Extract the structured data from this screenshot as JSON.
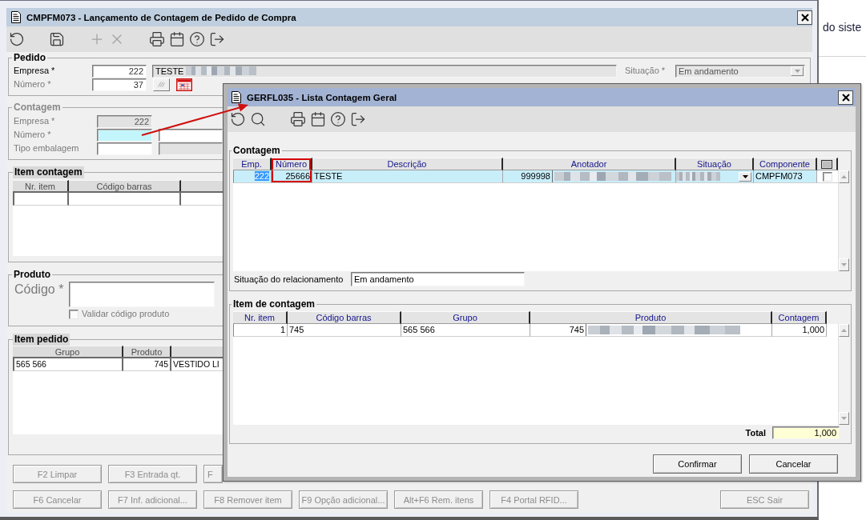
{
  "main_window": {
    "title": "CMPFM073 - Lançamento de Contagem de Pedido de Compra",
    "toolbar_groups": [
      [
        {
          "disabled": false
        }
      ],
      [
        {
          "disabled": false
        }
      ],
      [
        {
          "disabled": true
        },
        {
          "disabled": true
        }
      ],
      [
        {
          "disabled": false
        },
        {
          "disabled": false
        },
        {
          "disabled": false
        },
        {
          "disabled": false
        }
      ]
    ],
    "pedido": {
      "title": "Pedido",
      "disabled": false,
      "highlighted": false,
      "empresa": {
        "label": "Empresa *",
        "disabled": false,
        "value": "222",
        "description": "TESTE",
        "redacted": true
      },
      "numero": {
        "label": "Número *",
        "disabled": true,
        "value": "37"
      },
      "situacao": {
        "label": "Situação *",
        "disabled": true,
        "value": "Em andamento"
      }
    },
    "contagem": {
      "title": "Contagem",
      "disabled": true,
      "highlighted": false,
      "fields": [
        {
          "label": "Empresa *",
          "disabled": true,
          "value": "222",
          "readonly": true,
          "focused": false
        },
        {
          "label": "Número *",
          "disabled": true,
          "readonly": false,
          "focused": true,
          "side_field": {
            "readonly": false
          }
        },
        {
          "label": "Tipo embalagem",
          "disabled": true,
          "readonly": false,
          "focused": false,
          "side_field": {
            "readonly": true
          }
        }
      ]
    },
    "item_contagem": {
      "title": "Item contagem",
      "disabled": false,
      "highlighted": true,
      "columns": [
        "Nr. item",
        "Código barras"
      ]
    },
    "produto": {
      "title": "Produto",
      "disabled": false,
      "highlighted": false,
      "code_label": "Código *",
      "validate": {
        "label": "Validar código produto",
        "checked": false,
        "disabled": true
      }
    },
    "item_pedido": {
      "title": "Item pedido",
      "disabled": false,
      "highlighted": true,
      "columns": [
        "Grupo",
        "Produto"
      ],
      "rows": [
        [
          "565 566",
          "745",
          "VESTIDO LI"
        ]
      ]
    },
    "footer": {
      "row_1": [
        {
          "label": "F2 Limpar",
          "disabled": true,
          "clipped": false
        },
        {
          "label": "F3 Entrada qt.",
          "disabled": true,
          "clipped": false
        },
        {
          "label": "F",
          "disabled": true,
          "clipped": true
        }
      ],
      "row_2": [
        {
          "label": "F6 Cancelar",
          "disabled": true
        },
        {
          "label": "F7 Inf. adicional...",
          "disabled": true
        },
        {
          "label": "F8 Remover item",
          "disabled": true
        },
        {
          "label": "F9 Opção adicional...",
          "disabled": true
        },
        {
          "label": "Alt+F6 Rem. itens",
          "disabled": true
        },
        {
          "label": "F4 Portal RFID...",
          "disabled": true
        }
      ],
      "exit": {
        "label": "ESC Sair",
        "disabled": true
      }
    }
  },
  "background_window": {
    "text": "do siste"
  },
  "dialog": {
    "title": "GERFL035 - Lista Contagem Geral",
    "toolbar_groups": [
      [
        {
          "disabled": false
        },
        {
          "disabled": false
        }
      ],
      [
        {
          "disabled": false
        },
        {
          "disabled": false
        },
        {
          "disabled": false
        },
        {
          "disabled": false
        }
      ]
    ],
    "contagem": {
      "title": "Contagem",
      "columns": [
        {
          "label": "Emp.",
          "annotated": false
        },
        {
          "label": "Número",
          "annotated": true
        },
        {
          "label": "Descrição",
          "annotated": false
        },
        {
          "label": "Anotador",
          "annotated": false
        },
        {
          "label": "Situação",
          "annotated": false
        },
        {
          "label": "Componente",
          "annotated": false
        }
      ],
      "rows": [
        {
          "selected": true,
          "checked": false,
          "cells": [
            {
              "kind": "text",
              "text": "222",
              "highlighted": true,
              "redacted": false
            },
            {
              "kind": "text",
              "text": "25666",
              "highlighted": false,
              "redacted": false
            },
            {
              "kind": "text",
              "text": "TESTE",
              "highlighted": false,
              "redacted": false
            },
            {
              "kind": "text",
              "text": "999998",
              "highlighted": false,
              "redacted": true
            },
            {
              "kind": "combo",
              "highlighted": false,
              "redacted": true
            },
            {
              "kind": "text",
              "text": "CMPFM073",
              "highlighted": false,
              "redacted": false
            }
          ]
        }
      ],
      "relationship_status": {
        "label": "Situação do relacionamento",
        "value": "Em andamento"
      }
    },
    "item_contagem": {
      "title": "Item de contagem",
      "columns": [
        "Nr. item",
        "Código barras",
        "Grupo",
        "Produto",
        "Contagem"
      ],
      "rows": [
        {
          "selected": false,
          "cells": [
            {
              "kind": "text",
              "text": "1",
              "highlighted": false,
              "redacted": false
            },
            {
              "kind": "text",
              "text": "745",
              "highlighted": false,
              "redacted": false
            },
            {
              "kind": "text",
              "text": "565 566",
              "highlighted": false,
              "redacted": false
            },
            {
              "kind": "text",
              "text": "745",
              "highlighted": false,
              "redacted": true
            },
            {
              "kind": "text",
              "text": "1,000",
              "highlighted": false,
              "redacted": false
            }
          ]
        }
      ],
      "total": {
        "label": "Total",
        "value": "1,000"
      }
    },
    "buttons": [
      {
        "label": "Confirmar",
        "disabled": false
      },
      {
        "label": "Cancelar",
        "disabled": false
      }
    ]
  }
}
